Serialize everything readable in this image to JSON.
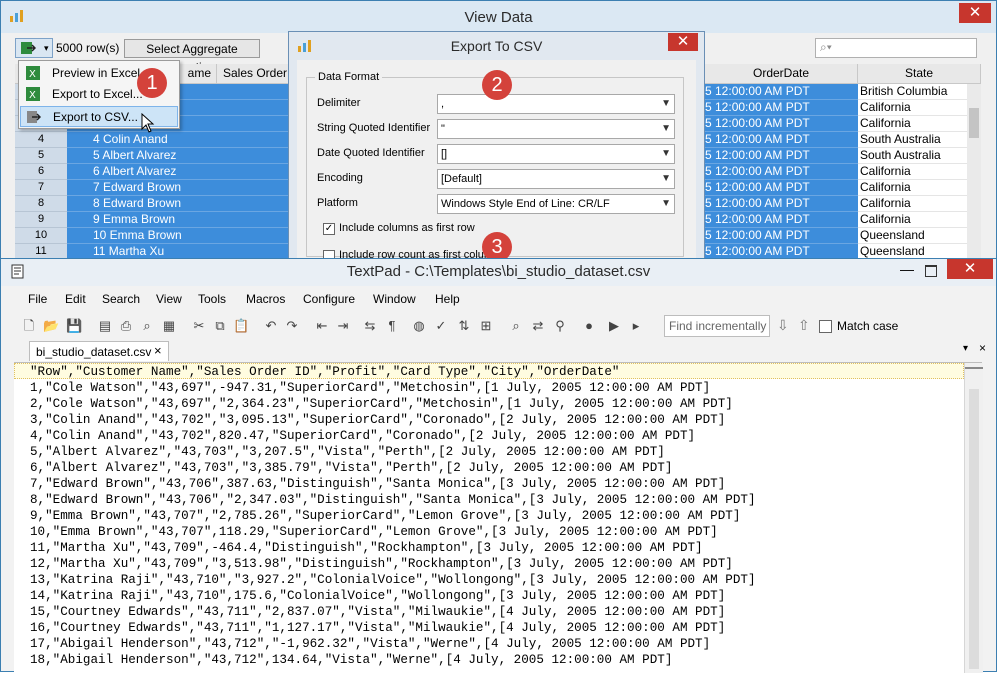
{
  "view_data": {
    "title": "View Data",
    "close": "✕",
    "row_count": "5000 row(s)",
    "aggregate_button": "Select Aggregate Function",
    "columns": {
      "name_partial": "ame",
      "sales_order": "Sales Order",
      "order_date": "OrderDate",
      "state": "State"
    },
    "rows": [
      {
        "num": "",
        "name": "",
        "sales": "43,",
        "date": "5 12:00:00 AM PDT",
        "state": "British Columbia"
      },
      {
        "num": "",
        "name": "",
        "sales": "43,",
        "date": "5 12:00:00 AM PDT",
        "state": "California"
      },
      {
        "num": "",
        "name": "",
        "sales": "43,",
        "date": "5 12:00:00 AM PDT",
        "state": "California"
      },
      {
        "num": "4",
        "name": "4 Colin Anand",
        "sales": "43,",
        "date": "5 12:00:00 AM PDT",
        "state": "South Australia"
      },
      {
        "num": "5",
        "name": "5 Albert Alvarez",
        "sales": "43,",
        "date": "5 12:00:00 AM PDT",
        "state": "South Australia"
      },
      {
        "num": "6",
        "name": "6 Albert Alvarez",
        "sales": "43,",
        "date": "5 12:00:00 AM PDT",
        "state": "California"
      },
      {
        "num": "7",
        "name": "7 Edward Brown",
        "sales": "43,",
        "date": "5 12:00:00 AM PDT",
        "state": "California"
      },
      {
        "num": "8",
        "name": "8 Edward Brown",
        "sales": "43,",
        "date": "5 12:00:00 AM PDT",
        "state": "California"
      },
      {
        "num": "9",
        "name": "9 Emma Brown",
        "sales": "43,",
        "date": "5 12:00:00 AM PDT",
        "state": "California"
      },
      {
        "num": "10",
        "name": "10 Emma Brown",
        "sales": "43,",
        "date": "5 12:00:00 AM PDT",
        "state": "Queensland"
      },
      {
        "num": "11",
        "name": "11 Martha Xu",
        "sales": "43,",
        "date": "5 12:00:00 AM PDT",
        "state": "Queensland"
      }
    ],
    "menu": [
      "Preview in Excel",
      "Export to Excel...",
      "Export to CSV..."
    ],
    "callouts": [
      "1",
      "2",
      "3"
    ]
  },
  "export_dialog": {
    "title": "Export To CSV",
    "close": "✕",
    "group": "Data Format",
    "fields": [
      {
        "label": "Delimiter",
        "value": ","
      },
      {
        "label": "String Quoted Identifier",
        "value": "\""
      },
      {
        "label": "Date Quoted Identifier",
        "value": "[]"
      },
      {
        "label": "Encoding",
        "value": "[Default]"
      },
      {
        "label": "Platform",
        "value": "Windows Style End of Line: CR/LF"
      }
    ],
    "checkbox1": "Include columns as first row",
    "checkbox2": "Include row count as first column"
  },
  "textpad": {
    "title": "TextPad - C:\\Templates\\bi_studio_dataset.csv",
    "menu": [
      "File",
      "Edit",
      "Search",
      "View",
      "Tools",
      "Macros",
      "Configure",
      "Window",
      "Help"
    ],
    "find_placeholder": "Find incrementally",
    "match_case": "Match case",
    "tab": "bi_studio_dataset.csv",
    "tab_close": "×",
    "lines": [
      "\"Row\",\"Customer Name\",\"Sales Order ID\",\"Profit\",\"Card Type\",\"City\",\"OrderDate\"",
      "1,\"Cole Watson\",\"43,697\",-947.31,\"SuperiorCard\",\"Metchosin\",[1 July, 2005 12:00:00 AM PDT]",
      "2,\"Cole Watson\",\"43,697\",\"2,364.23\",\"SuperiorCard\",\"Metchosin\",[1 July, 2005 12:00:00 AM PDT]",
      "3,\"Colin Anand\",\"43,702\",\"3,095.13\",\"SuperiorCard\",\"Coronado\",[2 July, 2005 12:00:00 AM PDT]",
      "4,\"Colin Anand\",\"43,702\",820.47,\"SuperiorCard\",\"Coronado\",[2 July, 2005 12:00:00 AM PDT]",
      "5,\"Albert Alvarez\",\"43,703\",\"3,207.5\",\"Vista\",\"Perth\",[2 July, 2005 12:00:00 AM PDT]",
      "6,\"Albert Alvarez\",\"43,703\",\"3,385.79\",\"Vista\",\"Perth\",[2 July, 2005 12:00:00 AM PDT]",
      "7,\"Edward Brown\",\"43,706\",387.63,\"Distinguish\",\"Santa Monica\",[3 July, 2005 12:00:00 AM PDT]",
      "8,\"Edward Brown\",\"43,706\",\"2,347.03\",\"Distinguish\",\"Santa Monica\",[3 July, 2005 12:00:00 AM PDT]",
      "9,\"Emma Brown\",\"43,707\",\"2,785.26\",\"SuperiorCard\",\"Lemon Grove\",[3 July, 2005 12:00:00 AM PDT]",
      "10,\"Emma Brown\",\"43,707\",118.29,\"SuperiorCard\",\"Lemon Grove\",[3 July, 2005 12:00:00 AM PDT]",
      "11,\"Martha Xu\",\"43,709\",-464.4,\"Distinguish\",\"Rockhampton\",[3 July, 2005 12:00:00 AM PDT]",
      "12,\"Martha Xu\",\"43,709\",\"3,513.98\",\"Distinguish\",\"Rockhampton\",[3 July, 2005 12:00:00 AM PDT]",
      "13,\"Katrina Raji\",\"43,710\",\"3,927.2\",\"ColonialVoice\",\"Wollongong\",[3 July, 2005 12:00:00 AM PDT]",
      "14,\"Katrina Raji\",\"43,710\",175.6,\"ColonialVoice\",\"Wollongong\",[3 July, 2005 12:00:00 AM PDT]",
      "15,\"Courtney Edwards\",\"43,711\",\"2,837.07\",\"Vista\",\"Milwaukie\",[4 July, 2005 12:00:00 AM PDT]",
      "16,\"Courtney Edwards\",\"43,711\",\"1,127.17\",\"Vista\",\"Milwaukie\",[4 July, 2005 12:00:00 AM PDT]",
      "17,\"Abigail Henderson\",\"43,712\",\"-1,962.32\",\"Vista\",\"Werne\",[4 July, 2005 12:00:00 AM PDT]",
      "18,\"Abigail Henderson\",\"43,712\",134.64,\"Vista\",\"Werne\",[4 July, 2005 12:00:00 AM PDT]"
    ]
  },
  "colors": {
    "selection": "#3d8ddb",
    "callout": "#d4423b",
    "close": "#c7362d"
  }
}
